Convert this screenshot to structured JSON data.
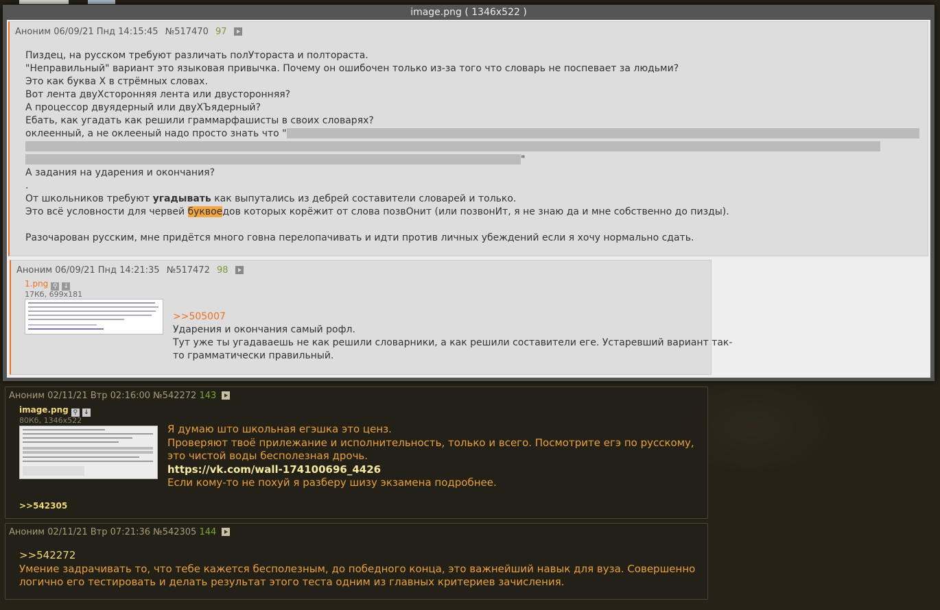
{
  "modal": {
    "title": "image.png ( 1346x522 )"
  },
  "modal_post1": {
    "author": "Аноним",
    "date": "06/09/21 Пнд 14:15:45",
    "number": "№517470",
    "count": "97",
    "lines": [
      "Пиздец, на русском требуют различать полУтораста и полтораста.",
      "\"Неправильный\" вариант это языковая привычка. Почему он ошибочен только из-за того что словарь не поспевает за людьми?",
      "Это как буква Х в стрёмных словах.",
      "Вот лента двуХсторонняя лента или двусторонняя?",
      "А процессор двуядерный или двуХЪядерный?",
      "Ебать, как угадать как решили граммарфашисты в своих словарях?",
      "оклеенный, а не оклееный надо просто знать что \""
    ],
    "spoiler_end": "\"",
    "lines2": [
      "А задания на ударения и окончания?",
      "."
    ],
    "line_bold_pre": "От школьников требуют ",
    "line_bold": "угадывать",
    "line_bold_post": " как выпутались из дебрей составители словарей и только.",
    "line_hl_pre": "Это всё условности для червей ",
    "line_hl": "буквое",
    "line_hl_post": "дов которых корёжит от слова позвОнит (или позвонИт, я не знаю да и мне собственно до пизды).",
    "last_line": "Разочарован русским, мне придётся много говна перелопачивать и идти против личных убеждений если я хочу нормально сдать."
  },
  "modal_post2": {
    "author": "Аноним",
    "date": "06/09/21 Пнд 14:21:35",
    "number": "№517472",
    "count": "98",
    "file_name": "1.png",
    "file_meta": "17Кб, 699x181",
    "reply": ">>505007",
    "lines": [
      "Ударения и окончания самый рофл.",
      "Тут уже ты угадаваешь не как решили словарники, а как решили составители еге. Устаревший вариант так-",
      "то грамматически правильный."
    ]
  },
  "post3": {
    "author": "Аноним",
    "date": "02/11/21 Втр 02:16:00",
    "number": "№542272",
    "count": "143",
    "file_name": "image.png",
    "file_meta": "80Кб, 1346x522",
    "lines": [
      "Я думаю што школьная егэшка это ценз.",
      "Проверяют твоё прилежание и исполнительность, только и всего. Посмотрите егэ по русскому,",
      "это чистой воды бесполезная дрочь."
    ],
    "link": "https://vk.com/wall-174100696_4426",
    "last_line": "Если кому-то не похуй я разберу шизу экзамена подробнее.",
    "backlink": ">>542305"
  },
  "post4": {
    "author": "Аноним",
    "date": "02/11/21 Втр 07:21:36",
    "number": "№542305",
    "count": "144",
    "reply": ">>542272",
    "lines": [
      "Умение задрачивать то, что тебе кажется бесполезным, до победного конца, это важнейший навык для вуза. Совершенно",
      "логично его тестировать и делать результат этого теста одним из главных критериев зачисления."
    ]
  }
}
